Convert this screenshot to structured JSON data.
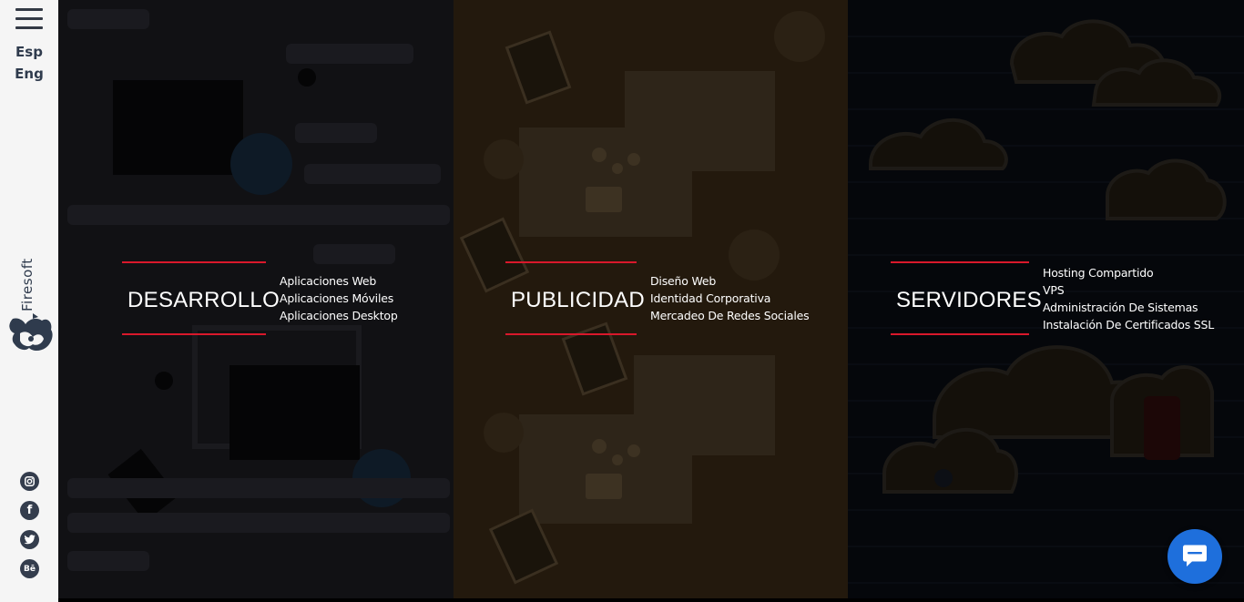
{
  "sidebar": {
    "languages": [
      "Esp",
      "Eng"
    ],
    "brand": "Firesoft",
    "social": [
      {
        "name": "instagram-icon"
      },
      {
        "name": "facebook-icon",
        "glyph": "f"
      },
      {
        "name": "twitter-icon"
      },
      {
        "name": "behance-icon",
        "glyph": "Bē"
      }
    ]
  },
  "services": [
    {
      "title": "DESARROLLO",
      "items": [
        "Aplicaciones Web",
        "Aplicaciones Móviles",
        "Aplicaciones Desktop"
      ]
    },
    {
      "title": "PUBLICIDAD",
      "items": [
        "Diseño Web",
        "Identidad Corporativa",
        "Mercadeo De Redes Sociales"
      ]
    },
    {
      "title": "SERVIDORES",
      "items": [
        "Hosting Compartido",
        "VPS",
        "Administración De Sistemas",
        "Instalación De Certificados SSL"
      ]
    }
  ],
  "colors": {
    "accent_line": "#d9182b",
    "chat_button": "#1e6fdc",
    "sidebar_bg": "#f5f5f5",
    "sidebar_text": "#2f3b4d"
  },
  "chat": {
    "icon": "chat-bubble-icon"
  }
}
